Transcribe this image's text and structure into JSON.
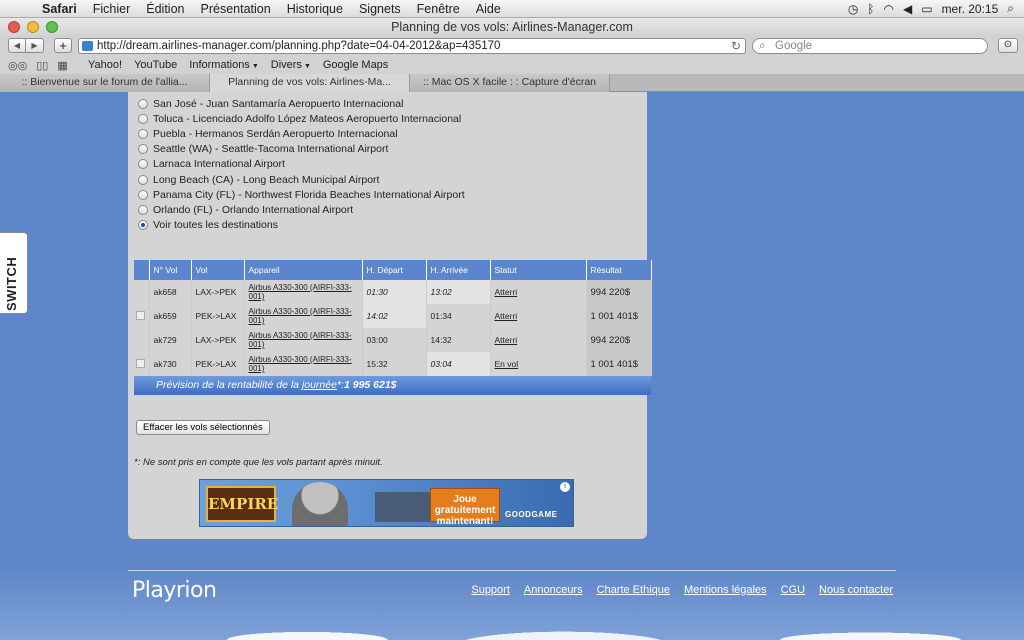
{
  "menubar": {
    "app": "Safari",
    "items": [
      "Fichier",
      "Édition",
      "Présentation",
      "Historique",
      "Signets",
      "Fenêtre",
      "Aide"
    ],
    "clock": "mer. 20:15"
  },
  "window": {
    "title": "Planning de vos vols: Airlines-Manager.com"
  },
  "toolbar": {
    "url": "http://dream.airlines-manager.com/planning.php?date=04-04-2012&ap=435170",
    "search_placeholder": "Google"
  },
  "bookmarks": {
    "items": [
      {
        "label": "Yahoo!",
        "menu": false
      },
      {
        "label": "YouTube",
        "menu": false
      },
      {
        "label": "Informations",
        "menu": true
      },
      {
        "label": "Divers",
        "menu": true
      },
      {
        "label": "Google Maps",
        "menu": false
      }
    ]
  },
  "tabs": [
    {
      "label": ":: Bienvenue sur le forum de l'allia...",
      "active": false
    },
    {
      "label": "Planning de vos vols: Airlines-Ma...",
      "active": true
    },
    {
      "label": ":: Mac OS X facile : : Capture d'écran",
      "active": false
    }
  ],
  "destinations": [
    {
      "label": "San José - Juan Santamaría Aeropuerto Internacional",
      "selected": false
    },
    {
      "label": "Toluca - Licenciado Adolfo López Mateos Aeropuerto Internacional",
      "selected": false
    },
    {
      "label": "Puebla - Hermanos Serdán Aeropuerto Internacional",
      "selected": false
    },
    {
      "label": "Seattle (WA) - Seattle-Tacoma International Airport",
      "selected": false
    },
    {
      "label": "Larnaca International Airport",
      "selected": false
    },
    {
      "label": "Long Beach (CA) - Long Beach Municipal Airport",
      "selected": false
    },
    {
      "label": "Panama City (FL) - Northwest Florida Beaches International Airport",
      "selected": false
    },
    {
      "label": "Orlando (FL) - Orlando International Airport",
      "selected": false
    },
    {
      "label": "Voir toutes les destinations",
      "selected": true
    }
  ],
  "flights": {
    "headers": [
      "N° Vol",
      "Vol",
      "Appareil",
      "H. Départ",
      "H. Arrivée",
      "Statut",
      "Résultat"
    ],
    "rows": [
      {
        "no": "ak658",
        "route": "LAX->PEK",
        "aircraft": "Airbus A330-300 (AIRFI-333-001)",
        "dep": "01:30",
        "arr": "13:02",
        "status": "Atterri",
        "result": "994 220$"
      },
      {
        "no": "ak659",
        "route": "PEK->LAX",
        "aircraft": "Airbus A330-300 (AIRFI-333-001)",
        "dep": "14:02",
        "arr": "01:34",
        "status": "Atterri",
        "result": "1 001 401$"
      },
      {
        "no": "ak729",
        "route": "LAX->PEK",
        "aircraft": "Airbus A330-300 (AIRFI-333-001)",
        "dep": "03:00",
        "arr": "14:32",
        "status": "Atterri",
        "result": "994 220$"
      },
      {
        "no": "ak730",
        "route": "PEK->LAX",
        "aircraft": "Airbus A330-300 (AIRFI-333-001)",
        "dep": "15:32",
        "arr": "03:04",
        "status": "En vol",
        "result": "1 001 401$"
      }
    ]
  },
  "forecast": {
    "prefix": "Prévision de la rentabilité de la ",
    "day": "journée",
    "suffix": "*:",
    "amount": "1 995 621$"
  },
  "delete_button": "Effacer les vols sélectionnés",
  "footnote": "*: Ne sont pris en compte que les vols partant après minuit.",
  "ad": {
    "logo": "EMPIRE",
    "cta": "Joue gratuitement maintenant!",
    "brand": "GOODGAME"
  },
  "switch_label": "SWITCH",
  "footer": {
    "brand": "Playrion",
    "links": [
      "Support",
      "Annonceurs",
      "Charte Ethique",
      "Mentions légales",
      "CGU",
      "Nous contacter"
    ]
  }
}
